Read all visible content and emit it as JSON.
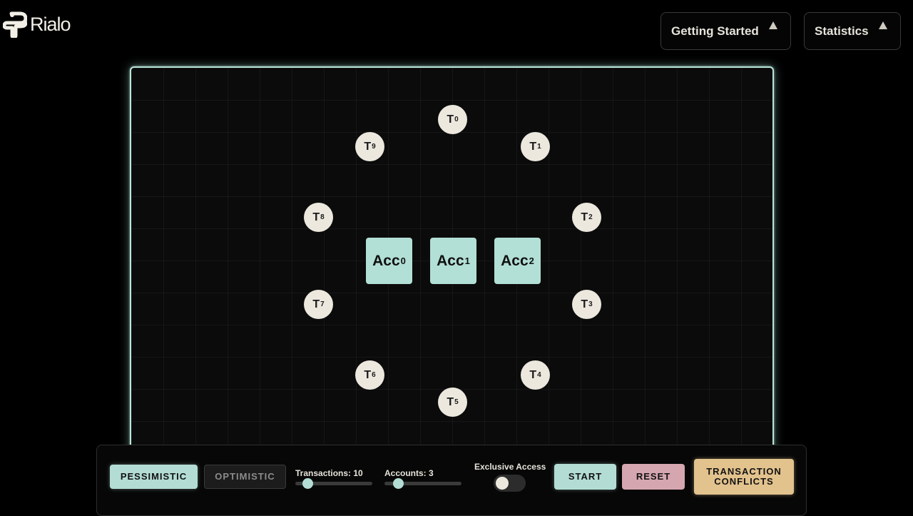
{
  "header": {
    "logo_text": "Rialo",
    "logo_icon": "rialo-logo-icon",
    "menus": [
      {
        "label": "Getting Started",
        "icon": "caret-up-icon"
      },
      {
        "label": "Statistics",
        "icon": "caret-up-icon"
      }
    ]
  },
  "canvas": {
    "transactions": [
      {
        "letter": "T",
        "index": "0"
      },
      {
        "letter": "T",
        "index": "1"
      },
      {
        "letter": "T",
        "index": "2"
      },
      {
        "letter": "T",
        "index": "3"
      },
      {
        "letter": "T",
        "index": "4"
      },
      {
        "letter": "T",
        "index": "5"
      },
      {
        "letter": "T",
        "index": "6"
      },
      {
        "letter": "T",
        "index": "7"
      },
      {
        "letter": "T",
        "index": "8"
      },
      {
        "letter": "T",
        "index": "9"
      }
    ],
    "accounts": [
      {
        "name": "Acc",
        "index": "0"
      },
      {
        "name": "Acc",
        "index": "1"
      },
      {
        "name": "Acc",
        "index": "2"
      }
    ]
  },
  "controls": {
    "pessimistic_label": "PESSIMISTIC",
    "optimistic_label": "OPTIMISTIC",
    "active_mode": "pessimistic",
    "transactions_label": "Transactions: 10",
    "transactions_value": 10,
    "accounts_label": "Accounts: 3",
    "accounts_value": 3,
    "exclusive_access_label": "Exclusive Access",
    "exclusive_access_on": false,
    "start_label": "START",
    "reset_label": "RESET",
    "conflicts_label_line1": "TRANSACTION",
    "conflicts_label_line2": "CONFLICTS"
  },
  "colors": {
    "accent_teal": "#b3ddd4",
    "reset_pink": "#d6a6b0",
    "conflicts_gold": "#e2c28d",
    "node_cream": "#ece8de",
    "background": "#000000"
  }
}
